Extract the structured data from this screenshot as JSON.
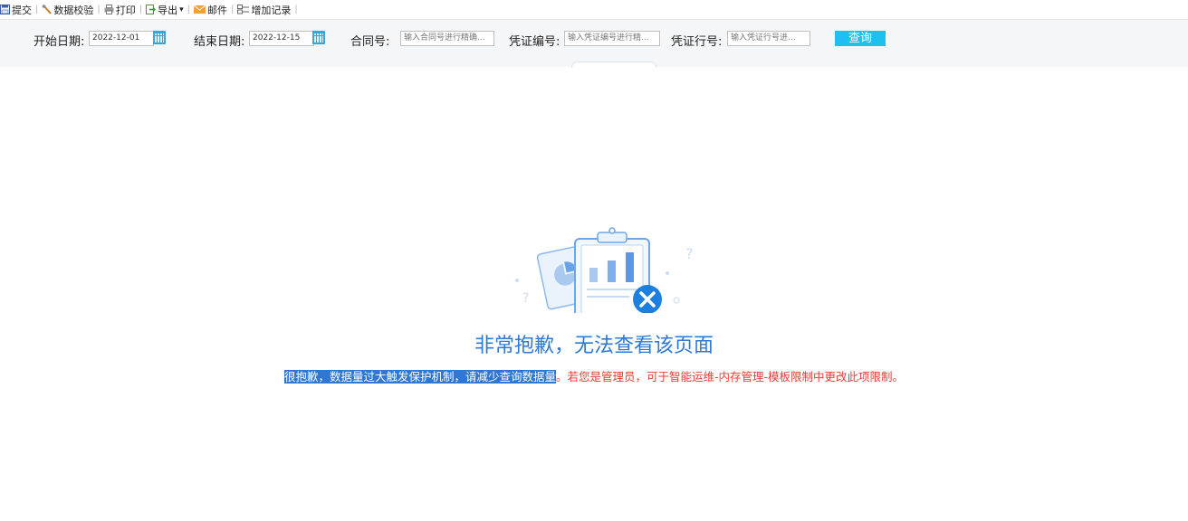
{
  "toolbar": {
    "items": [
      {
        "label": "提交",
        "icon": "submit-icon"
      },
      {
        "label": "数据校验",
        "icon": "data-verify-icon"
      },
      {
        "label": "打印",
        "icon": "printer-icon"
      },
      {
        "label": "导出",
        "icon": "export-icon"
      },
      {
        "label": "邮件",
        "icon": "mail-icon"
      },
      {
        "label": "增加记录",
        "icon": "add-record-icon"
      }
    ],
    "export_arrow": "▾",
    "separator": "|"
  },
  "filters": {
    "start_date": {
      "label": "开始日期:",
      "value": "2022-12-01"
    },
    "end_date": {
      "label": "结束日期:",
      "value": "2022-12-15"
    },
    "contract_no": {
      "label": "合同号:",
      "placeholder": "输入合同号进行精确..."
    },
    "voucher_no": {
      "label": "凭证编号:",
      "placeholder": "输入凭证编号进行精..."
    },
    "voucher_line": {
      "label": "凭证行号:",
      "placeholder": "输入凭证行号进..."
    },
    "query_button": "查询"
  },
  "error": {
    "title": "非常抱歉，无法查看该页面",
    "message_highlighted": "很抱歉，数据量过大触发保护机制，请减少查询数据量",
    "message_rest": "。若您是管理员，可于智能运维-内存管理-模板限制中更改此项限制。"
  },
  "colors": {
    "title": "#2d79d6",
    "message": "#e83d35",
    "highlight": "#2f77d3",
    "query_button": "#1ec0f0",
    "error_badge": "#1d7fe0"
  }
}
